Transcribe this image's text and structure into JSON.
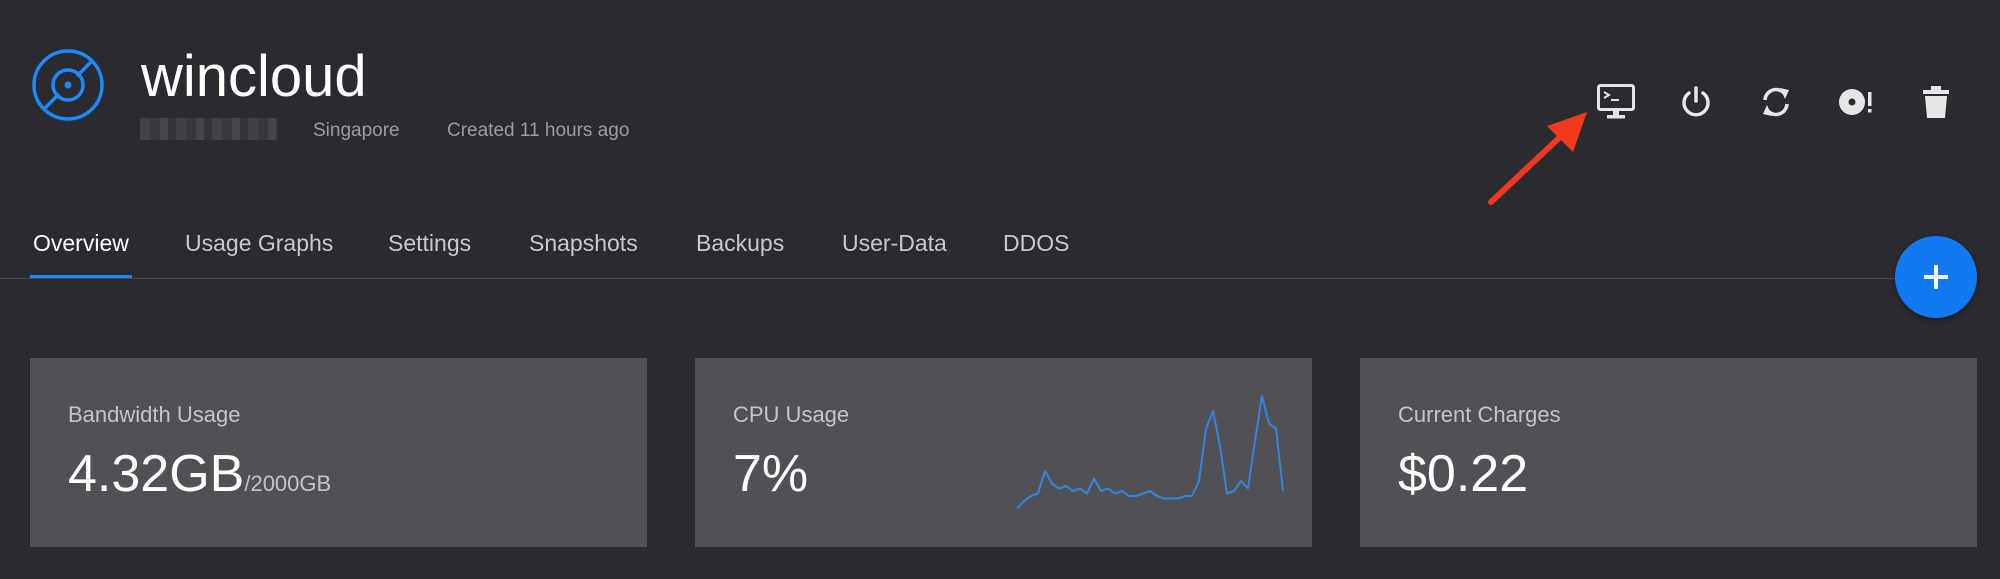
{
  "server": {
    "name": "wincloud",
    "location": "Singapore",
    "created": "Created 11 hours ago"
  },
  "actions": [
    {
      "name": "console",
      "icon": "monitor-console-icon"
    },
    {
      "name": "power",
      "icon": "power-icon"
    },
    {
      "name": "restart",
      "icon": "refresh-icon"
    },
    {
      "name": "reinstall",
      "icon": "disc-alert-icon"
    },
    {
      "name": "destroy",
      "icon": "trash-icon"
    }
  ],
  "tabs": [
    {
      "label": "Overview",
      "active": true
    },
    {
      "label": "Usage Graphs"
    },
    {
      "label": "Settings"
    },
    {
      "label": "Snapshots"
    },
    {
      "label": "Backups"
    },
    {
      "label": "User-Data"
    },
    {
      "label": "DDOS"
    }
  ],
  "fab": {
    "label": "+"
  },
  "cards": {
    "bandwidth": {
      "label": "Bandwidth Usage",
      "value": "4.32GB",
      "limit": "/2000GB"
    },
    "cpu": {
      "label": "CPU Usage",
      "value": "7%"
    },
    "charges": {
      "label": "Current Charges",
      "value": "$0.22"
    }
  },
  "colors": {
    "background": "#2a2b30",
    "card": "#515155",
    "accent": "#1279f5",
    "annotation": "#f2391f",
    "sparkline": "#2f86e0"
  },
  "chart_data": {
    "type": "line",
    "title": "",
    "values": [
      3,
      6,
      8,
      9,
      18,
      13,
      11,
      12,
      10,
      11,
      9,
      15,
      10,
      11,
      9,
      10,
      8,
      8,
      9,
      10,
      8,
      7,
      7,
      7,
      8,
      8,
      14,
      35,
      42,
      28,
      9,
      10,
      14,
      11,
      30,
      48,
      37,
      35,
      10
    ]
  }
}
